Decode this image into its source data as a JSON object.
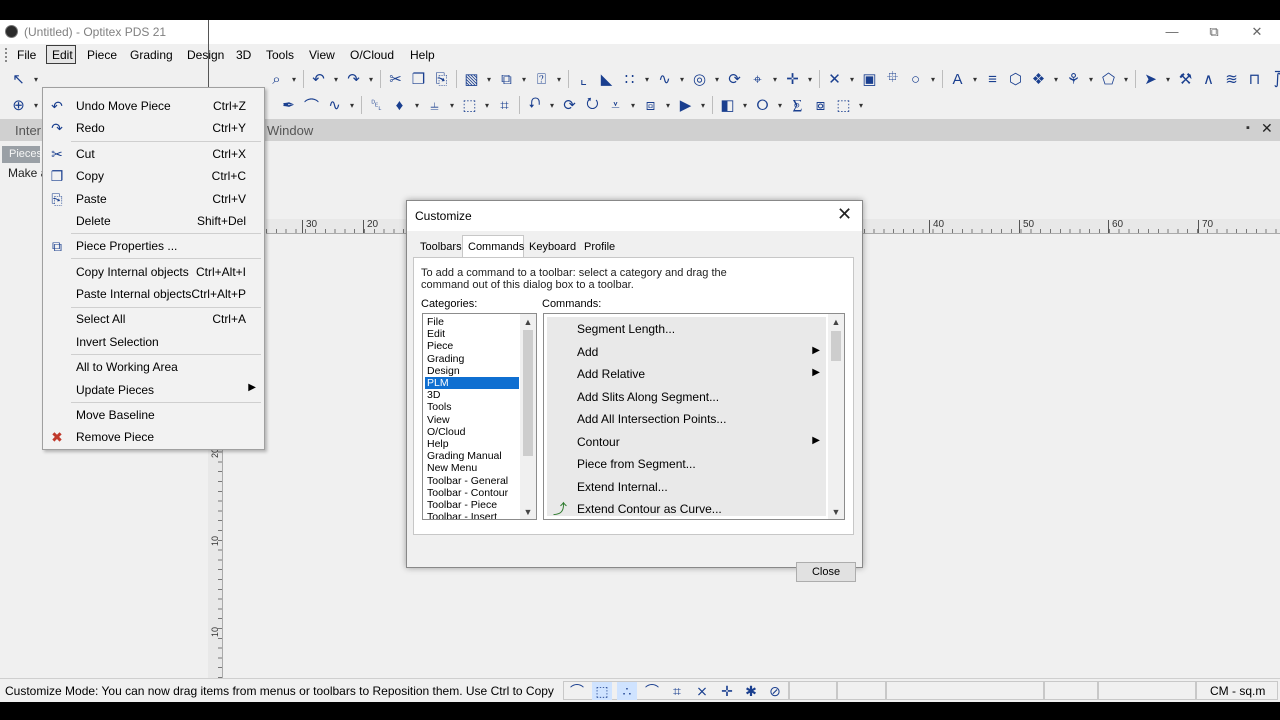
{
  "window": {
    "title": "(Untitled) - Optitex PDS 21",
    "minimize_glyph": "—",
    "restore_glyph": "⧉",
    "close_glyph": "✕"
  },
  "menubar": {
    "items": [
      "File",
      "Edit",
      "Piece",
      "Grading",
      "Design",
      "3D",
      "Tools",
      "View",
      "O/Cloud",
      "Help"
    ]
  },
  "panel": {
    "title": "Inter",
    "tab": "Pieces",
    "text": "Make a"
  },
  "piece_window": {
    "title": "Window",
    "pin_glyph": "▪",
    "close_glyph": "✕"
  },
  "rulers": {
    "h_labels": [
      "30",
      "20",
      "40",
      "50",
      "60",
      "70"
    ],
    "v_labels": [
      "20",
      "10",
      "10"
    ]
  },
  "edit_menu": {
    "items": [
      {
        "label": "Undo Move Piece",
        "shortcut": "Ctrl+Z",
        "icon": "undo-icon",
        "glyph": "↶"
      },
      {
        "label": "Redo",
        "shortcut": "Ctrl+Y",
        "icon": "redo-icon",
        "glyph": "↷"
      },
      {
        "label": "Cut",
        "shortcut": "Ctrl+X",
        "icon": "scissors-icon",
        "glyph": "✂"
      },
      {
        "label": "Copy",
        "shortcut": "Ctrl+C",
        "icon": "copy-icon",
        "glyph": "❐"
      },
      {
        "label": "Paste",
        "shortcut": "Ctrl+V",
        "icon": "clipboard-icon",
        "glyph": "⎘"
      },
      {
        "label": "Delete",
        "shortcut": "Shift+Del",
        "icon": "",
        "glyph": ""
      },
      {
        "label": "Piece Properties ...",
        "shortcut": "",
        "icon": "piece-properties-icon",
        "glyph": "⧉"
      },
      {
        "label": "Copy Internal objects",
        "shortcut": "Ctrl+Alt+I",
        "icon": "",
        "glyph": ""
      },
      {
        "label": "Paste Internal objects",
        "shortcut": "Ctrl+Alt+P",
        "icon": "",
        "glyph": ""
      },
      {
        "label": "Select All",
        "shortcut": "Ctrl+A",
        "icon": "",
        "glyph": ""
      },
      {
        "label": "Invert Selection",
        "shortcut": "",
        "icon": "",
        "glyph": ""
      },
      {
        "label": "All to Working Area",
        "shortcut": "",
        "icon": "",
        "glyph": ""
      },
      {
        "label": "Update Pieces",
        "shortcut": "",
        "icon": "",
        "glyph": "",
        "submenu": "▶"
      },
      {
        "label": "Move Baseline",
        "shortcut": "",
        "icon": "",
        "glyph": ""
      },
      {
        "label": "Remove Piece",
        "shortcut": "",
        "icon": "remove-piece-icon",
        "glyph": "✖"
      }
    ]
  },
  "dialog": {
    "title": "Customize",
    "close_glyph": "✕",
    "tabs": [
      "Toolbars",
      "Commands",
      "Keyboard",
      "Profile"
    ],
    "active_tab": "Commands",
    "instructions": "To add a command to a toolbar: select a category and drag the command out of this dialog box to a toolbar.",
    "categories_label": "Categories:",
    "commands_label": "Commands:",
    "categories": [
      "File",
      "Edit",
      "Piece",
      "Grading",
      "Design",
      "PLM",
      "3D",
      "Tools",
      "View",
      "O/Cloud",
      "Help",
      "Grading Manual",
      "New Menu",
      "Toolbar - General",
      "Toolbar - Contour",
      "Toolbar - Piece",
      "Toolbar - Insert"
    ],
    "selected_category": "PLM",
    "commands": [
      {
        "label": "Segment Length...",
        "submenu": ""
      },
      {
        "label": "Add",
        "submenu": "▶"
      },
      {
        "label": "Add Relative",
        "submenu": "▶"
      },
      {
        "label": "Add Slits Along Segment...",
        "submenu": ""
      },
      {
        "label": "Add All Intersection Points...",
        "submenu": ""
      },
      {
        "label": "Contour",
        "submenu": "▶"
      },
      {
        "label": "Piece from Segment...",
        "submenu": ""
      },
      {
        "label": "Extend Internal...",
        "submenu": ""
      },
      {
        "label": "Extend Contour as Curve...",
        "submenu": "",
        "icon": "extend-contour-icon",
        "glyph": "⤴"
      }
    ],
    "close_button": "Close",
    "scroll_up": "▲",
    "scroll_down": "▼"
  },
  "statusbar": {
    "text": "Customize Mode: You can now drag items from menus or toolbars to Reposition them. Use Ctrl to Copy",
    "unit": "CM - sq.m"
  }
}
